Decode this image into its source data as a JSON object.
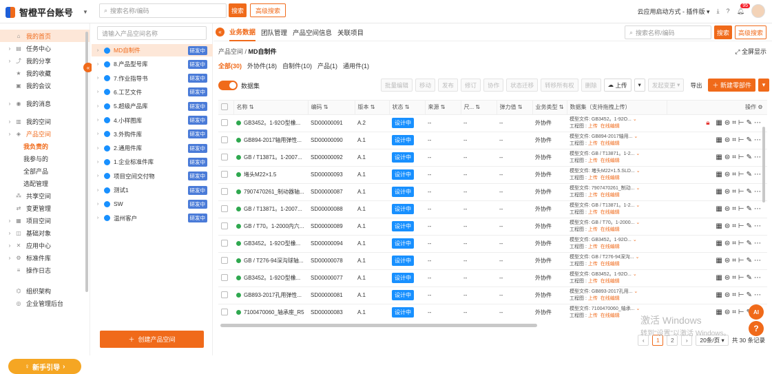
{
  "top": {
    "brand": "智橙平台账号",
    "search_placeholder": "搜索名称/编码",
    "search_btn": "搜索",
    "adv_search_btn": "高级搜索",
    "launch_mode": "云应用启动方式 - 插件版",
    "badge": "95"
  },
  "nav": {
    "items": [
      {
        "label": "我的首页",
        "icon": "home-icon"
      },
      {
        "label": "任务中心",
        "icon": "task-icon"
      },
      {
        "label": "我的分享",
        "icon": "share-icon"
      },
      {
        "label": "我的收藏",
        "icon": "star-icon"
      },
      {
        "label": "我的会议",
        "icon": "meeting-icon"
      },
      {
        "label": "我的消息",
        "icon": "bell-icon"
      },
      {
        "label": "我的空间",
        "icon": "space-icon"
      },
      {
        "label": "产品空间",
        "icon": "product-icon"
      }
    ],
    "sub": [
      "我负责的",
      "我参与的",
      "全部产品",
      "选配管理"
    ],
    "items2": [
      {
        "label": "共享空间",
        "icon": "share-space-icon"
      },
      {
        "label": "变更管理",
        "icon": "change-icon"
      },
      {
        "label": "项目空间",
        "icon": "project-icon"
      },
      {
        "label": "基础对象",
        "icon": "object-icon"
      },
      {
        "label": "应用中心",
        "icon": "app-icon"
      },
      {
        "label": "标准件库",
        "icon": "standard-icon"
      },
      {
        "label": "操作日志",
        "icon": "log-icon"
      },
      {
        "label": "组织架构",
        "icon": "org-icon"
      },
      {
        "label": "企业管理后台",
        "icon": "admin-icon"
      }
    ],
    "guide": "新手引导"
  },
  "tree": {
    "search_placeholder": "请输入产品空间名称",
    "tag": "研发中",
    "rows": [
      "MD自制件",
      "8.产品型号库",
      "7.作业指导书",
      "6.工艺文件",
      "5.超级产品库",
      "4.小样图库",
      "3.外购件库",
      "2.通用件库",
      "1.企业标准件库",
      "项目空间交付物",
      "测试1",
      "SW",
      "温州客户"
    ],
    "create_btn": "创建产品空间"
  },
  "main": {
    "tabs": [
      "业务数据",
      "团队管理",
      "产品空间信息",
      "关联项目"
    ],
    "search_placeholder": "搜索名称/编码",
    "search_btn": "搜索",
    "adv_search_btn": "高级搜索",
    "bc_root": "产品空间 /",
    "bc_cur": "MD自制件",
    "fullscreen": "全屏显示",
    "subtabs": [
      "全部(30)",
      "外协件(18)",
      "自制件(10)",
      "产品(1)",
      "通用件(1)"
    ],
    "dataset_label": "数据集",
    "toolbar": [
      "批量编辑",
      "移动",
      "发布",
      "修订",
      "协作",
      "状态迁移",
      "转移所有权",
      "删除"
    ],
    "upload": "上传",
    "initiate_change": "发起变更",
    "export": "导出",
    "new_part": "新建零部件"
  },
  "table": {
    "headers": [
      "名称",
      "编码",
      "版本",
      "状态",
      "来源",
      "尺...",
      "弹力值",
      "业务类型",
      "数据集（支持拖拽上传）",
      "操作"
    ],
    "ds_model": "模型文件:",
    "ds_drawing": "工程图 :",
    "ds_upload": "上传",
    "ds_edit": "在线编辑",
    "rows": [
      {
        "name": "GB3452。1-92O型橡...",
        "code": "SD00000091",
        "ver": "A.2",
        "status": "设计中",
        "src": "--",
        "size": "--",
        "elastic": "--",
        "biz": "外协件",
        "model": "GB3452。1-92O...",
        "lock": true
      },
      {
        "name": "GB894-2017轴用弹性...",
        "code": "SD00000090",
        "ver": "A.1",
        "status": "设计中",
        "src": "--",
        "size": "--",
        "elastic": "--",
        "biz": "外协件",
        "model": "GB894-2017轴用...",
        "lock": false
      },
      {
        "name": "GB / T13871。1-2007...",
        "code": "SD00000092",
        "ver": "A.1",
        "status": "设计中",
        "src": "--",
        "size": "--",
        "elastic": "--",
        "biz": "外协件",
        "model": "GB / T13871。1-2...",
        "lock": false
      },
      {
        "name": "堵头M22×1.5",
        "code": "SD00000093",
        "ver": "A.1",
        "status": "设计中",
        "src": "--",
        "size": "--",
        "elastic": "--",
        "biz": "外协件",
        "model": "堵头M22×1.5.SLD...",
        "lock": false
      },
      {
        "name": "7907470261_制动器轴...",
        "code": "SD00000087",
        "ver": "A.1",
        "status": "设计中",
        "src": "--",
        "size": "--",
        "elastic": "--",
        "biz": "外协件",
        "model": "7907470261_制动...",
        "lock": false
      },
      {
        "name": "GB / T13871。1-2007...",
        "code": "SD00000088",
        "ver": "A.1",
        "status": "设计中",
        "src": "--",
        "size": "--",
        "elastic": "--",
        "biz": "外协件",
        "model": "GB / T13871。1-2...",
        "lock": false
      },
      {
        "name": "GB / T70。1-2000内六...",
        "code": "SD00000089",
        "ver": "A.1",
        "status": "设计中",
        "src": "--",
        "size": "--",
        "elastic": "--",
        "biz": "外协件",
        "model": "GB / T70。1-2000...",
        "lock": false
      },
      {
        "name": "GB3452。1-92O型橡...",
        "code": "SD00000094",
        "ver": "A.1",
        "status": "设计中",
        "src": "--",
        "size": "--",
        "elastic": "--",
        "biz": "外协件",
        "model": "GB3452。1-92O...",
        "lock": false
      },
      {
        "name": "GB / T276-94深沟球轴...",
        "code": "SD00000078",
        "ver": "A.1",
        "status": "设计中",
        "src": "--",
        "size": "--",
        "elastic": "--",
        "biz": "外协件",
        "model": "GB / T276-94深沟...",
        "lock": false
      },
      {
        "name": "GB3452。1-92O型橡...",
        "code": "SD00000077",
        "ver": "A.1",
        "status": "设计中",
        "src": "--",
        "size": "--",
        "elastic": "--",
        "biz": "外协件",
        "model": "GB3452。1-92O...",
        "lock": false
      },
      {
        "name": "GB893-2017孔用弹性...",
        "code": "SD00000081",
        "ver": "A.1",
        "status": "设计中",
        "src": "--",
        "size": "--",
        "elastic": "--",
        "biz": "外协件",
        "model": "GB893-2017孔用...",
        "lock": false
      },
      {
        "name": "7100470060_轴承座_R5",
        "code": "SD00000083",
        "ver": "A.1",
        "status": "设计中",
        "src": "--",
        "size": "--",
        "elastic": "--",
        "biz": "外协件",
        "model": "7100470060_轴承...",
        "lock": false
      }
    ]
  },
  "pager": {
    "p1": "1",
    "p2": "2",
    "size": "20条/页",
    "total": "共 30 条记录"
  },
  "overlay": {
    "activate1": "激活 Windows",
    "activate2": "转到\"设置\"以激活 Windows。",
    "ai": "AI",
    "help": "?"
  },
  "colors": {
    "accent": "#f06a1a",
    "status_blue": "#1890ff",
    "tag_blue": "#4a7bd8"
  }
}
